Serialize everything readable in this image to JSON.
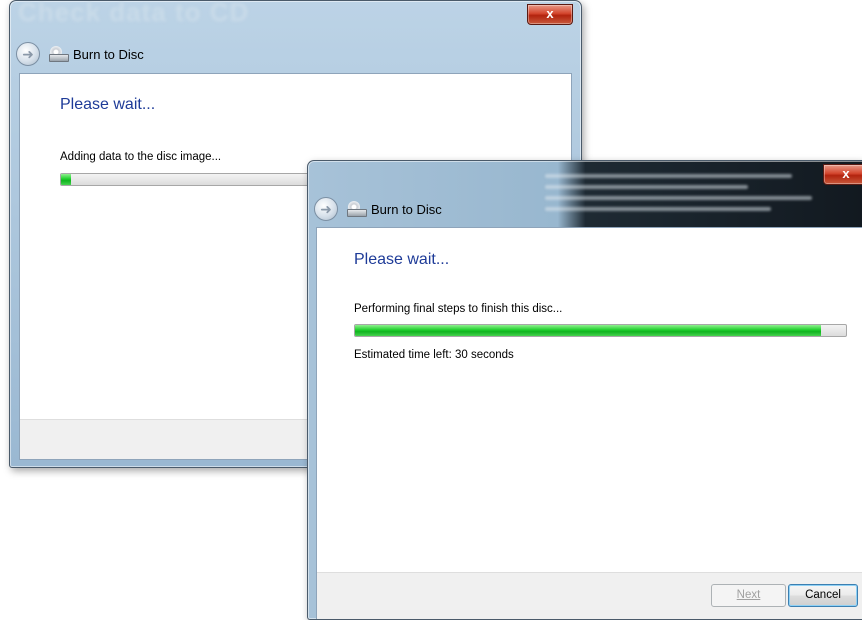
{
  "back_window": {
    "title_text": "Check data to CD",
    "close_glyph": "x",
    "back_icon": "back-arrow-icon",
    "burn_icon": "burn-disc-icon",
    "nav_title": "Burn to Disc",
    "heading": "Please wait...",
    "status_text": "Adding data to the disc image...",
    "progress": 0.02
  },
  "front_window": {
    "close_glyph": "x",
    "back_icon": "back-arrow-icon",
    "burn_icon": "burn-disc-icon",
    "nav_title": "Burn to Disc",
    "heading": "Please wait...",
    "status_text": "Performing final steps to finish this disc...",
    "progress": 0.95,
    "time_left_text": "Estimated time left: 30 seconds",
    "next_label": "Next",
    "cancel_label": "Cancel"
  },
  "colors": {
    "heading_blue": "#1e3b98",
    "progress_green": "#1fcf2c",
    "close_red": "#c43a22"
  }
}
